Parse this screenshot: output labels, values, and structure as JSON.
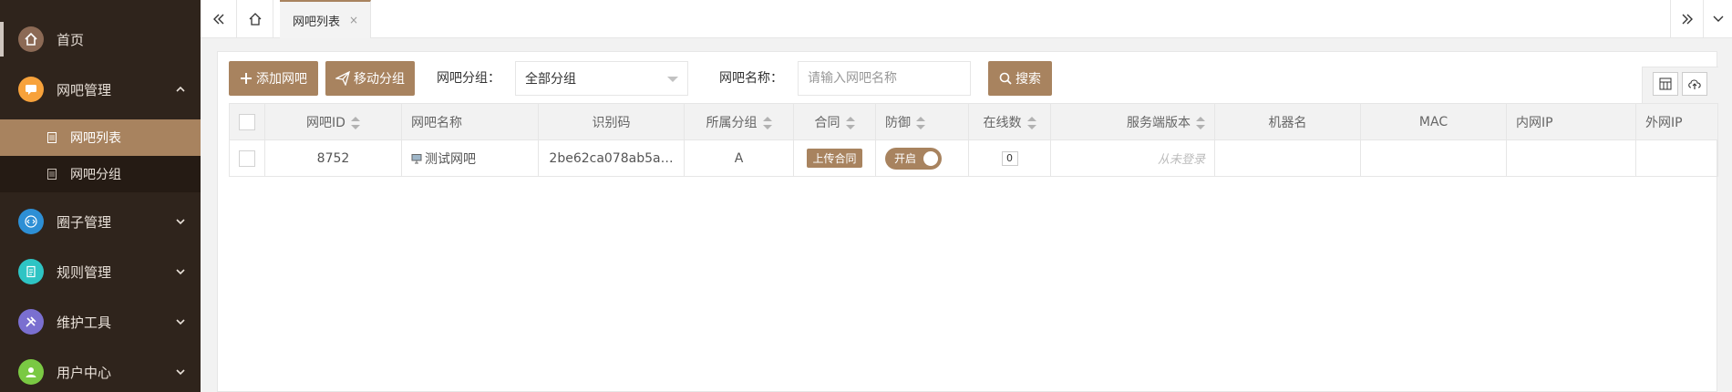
{
  "sidebar": {
    "items": [
      {
        "label": "首页",
        "icon": "home-icon",
        "color": "#8c6a55"
      },
      {
        "label": "网吧管理",
        "icon": "chat-icon",
        "color": "#f7a23b"
      },
      {
        "label": "圈子管理",
        "icon": "code-icon",
        "color": "#2d8fd5"
      },
      {
        "label": "规则管理",
        "icon": "doc-icon",
        "color": "#2ec4c4"
      },
      {
        "label": "维护工具",
        "icon": "tools-icon",
        "color": "#7a6fd0"
      },
      {
        "label": "用户中心",
        "icon": "user-icon",
        "color": "#7ac943"
      }
    ],
    "submenu": [
      {
        "label": "网吧列表"
      },
      {
        "label": "网吧分组"
      }
    ]
  },
  "topbar": {
    "active_tab": "网吧列表",
    "close_glyph": "×"
  },
  "toolbar": {
    "add_label": "添加网吧",
    "move_label": "移动分组",
    "group_label": "网吧分组：",
    "group_value": "全部分组",
    "name_label": "网吧名称：",
    "name_placeholder": "请输入网吧名称",
    "search_label": "搜索"
  },
  "table": {
    "headers": [
      "网吧ID",
      "网吧名称",
      "识别码",
      "所属分组",
      "合同",
      "防御",
      "在线数",
      "服务端版本",
      "机器名",
      "MAC",
      "内网IP",
      "外网IP"
    ],
    "rows": [
      {
        "id": "8752",
        "name": "测试网吧",
        "code": "2be62ca078ab5a…",
        "group": "A",
        "contract": "上传合同",
        "defense": "开启",
        "online": "0",
        "version": "从未登录",
        "machine": "",
        "mac": "",
        "lan_ip": "",
        "wan_ip": ""
      }
    ]
  },
  "colors": {
    "accent": "#a8835f",
    "sidebar_bg": "#2f241c"
  }
}
